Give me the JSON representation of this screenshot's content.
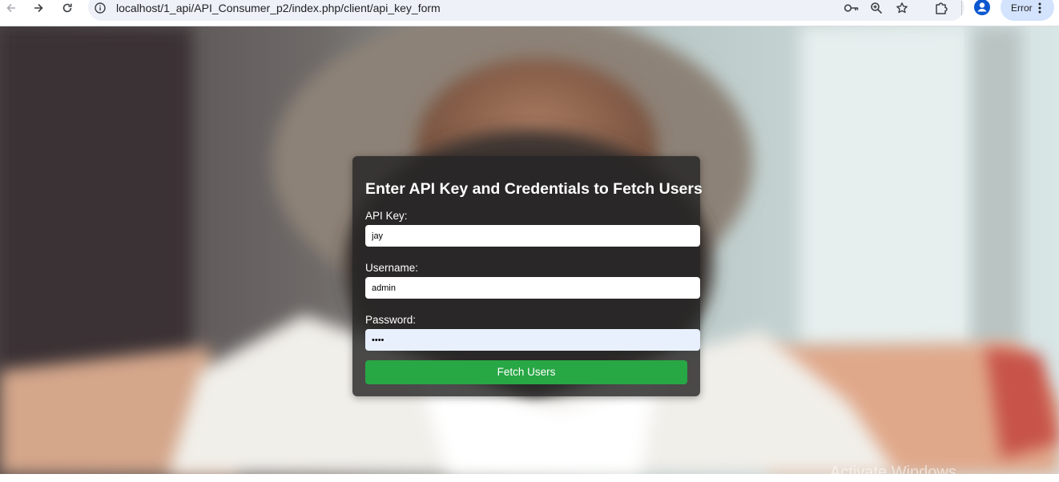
{
  "browser": {
    "url": "localhost/1_api/API_Consumer_p2/index.php/client/api_key_form",
    "profile_status": "Error",
    "icons": [
      "back-icon",
      "forward-icon",
      "reload-icon",
      "site-info-icon",
      "password-key-icon",
      "zoom-icon",
      "bookmark-star-icon",
      "extensions-icon",
      "profile-avatar-icon",
      "menu-kebab-icon"
    ]
  },
  "form": {
    "title": "Enter API Key and Credentials to Fetch Users",
    "api_key_label": "API Key:",
    "api_key_value": "jay",
    "username_label": "Username:",
    "username_value": "admin",
    "password_label": "Password:",
    "password_value": "1234",
    "submit_label": "Fetch Users"
  },
  "watermark": "Activate Windows",
  "colors": {
    "submit_button": "#28a745",
    "card_background": "#242424",
    "omnibox": "#eef2f8",
    "error_pill": "#d3e3fd"
  }
}
